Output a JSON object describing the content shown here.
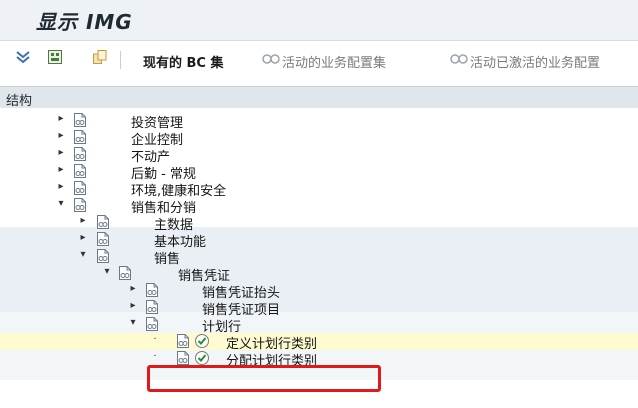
{
  "title": "显示 IMG",
  "toolbar": {
    "icons": [
      "filter-icon",
      "save-layout-icon",
      "copy-icon"
    ],
    "existing_bc_sets": "现有的 BC 集",
    "active_business_config": "活动的业务配置集",
    "active_deactivated_config": "活动已激活的业务配置"
  },
  "structure": {
    "header": "结构",
    "rows": [
      {
        "label": "投资管理",
        "arrow": "▸",
        "level": 0
      },
      {
        "label": "企业控制",
        "arrow": "▸",
        "level": 0
      },
      {
        "label": "不动产",
        "arrow": "▸",
        "level": 0
      },
      {
        "label": "后勤 - 常规",
        "arrow": "▸",
        "level": 0
      },
      {
        "label": "环境,健康和安全",
        "arrow": "▸",
        "level": 0
      },
      {
        "label": "销售和分销",
        "arrow": "▾",
        "level": 0
      },
      {
        "label": "主数据",
        "arrow": "▸",
        "level": 1
      },
      {
        "label": "基本功能",
        "arrow": "▸",
        "level": 1
      },
      {
        "label": "销售",
        "arrow": "▾",
        "level": 1
      },
      {
        "label": "销售凭证",
        "arrow": "▾",
        "level": 2
      },
      {
        "label": "销售凭证抬头",
        "arrow": "▸",
        "level": 3
      },
      {
        "label": "销售凭证项目",
        "arrow": "▸",
        "level": 3
      },
      {
        "label": "计划行",
        "arrow": "▾",
        "level": 3
      },
      {
        "label": "定义计划行类别",
        "arrow": "·",
        "level": 4,
        "exec": true,
        "selected": true
      },
      {
        "label": "分配计划行类别",
        "arrow": "·",
        "level": 4,
        "exec": true
      }
    ]
  },
  "colors": {
    "title_bar": "#eef2f6",
    "header_bar": "#e1e6eb",
    "band": "#e9eff4",
    "selected_row": "#fffbd1",
    "focus_border": "#e0191b"
  }
}
